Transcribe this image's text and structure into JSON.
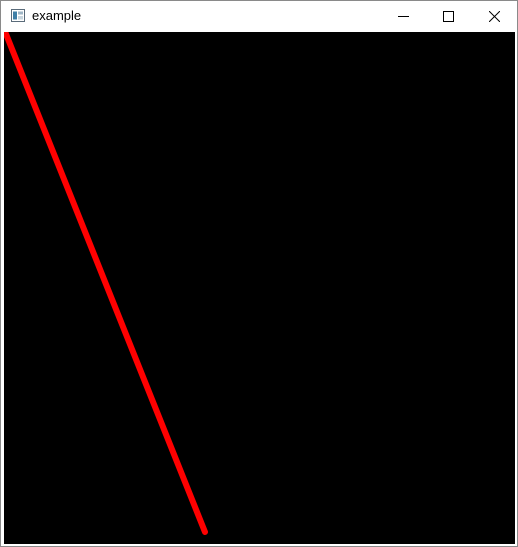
{
  "window": {
    "title": "example",
    "app_icon": "window-app-icon",
    "controls": {
      "minimize_icon": "minimize-icon",
      "maximize_icon": "maximize-icon",
      "close_icon": "close-icon"
    }
  },
  "canvas": {
    "background_color": "#000000",
    "line_color": "#ff0000"
  }
}
